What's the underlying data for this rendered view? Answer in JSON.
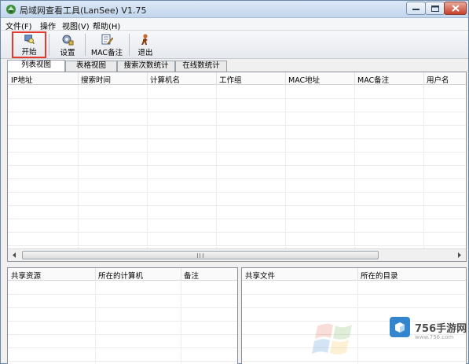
{
  "window": {
    "title": "局域网查看工具(LanSee) V1.75"
  },
  "menu": [
    "文件(F)",
    "操作",
    "视图(V)",
    "帮助(H)"
  ],
  "toolbar": {
    "start": "开始",
    "settings": "设置",
    "mac_note": "MAC备注",
    "quit": "退出"
  },
  "tabs": [
    "列表视图",
    "表格视图",
    "搜索次数统计",
    "在线数统计"
  ],
  "active_tab": "列表视图",
  "main_table": {
    "columns": [
      "IP地址",
      "搜索时间",
      "计算机名",
      "工作组",
      "MAC地址",
      "MAC备注",
      "用户名"
    ],
    "rows": []
  },
  "shares_table": {
    "columns": [
      "共享资源",
      "所在的计算机",
      "备注"
    ],
    "rows": []
  },
  "files_table": {
    "columns": [
      "共享文件",
      "所在的目录"
    ],
    "rows": []
  },
  "watermark": {
    "brand": "756手游网",
    "url": "www.756.com"
  },
  "colors": {
    "highlight": "#e3392f",
    "close_button": "#c6412b",
    "brand": "#1e78c8"
  }
}
